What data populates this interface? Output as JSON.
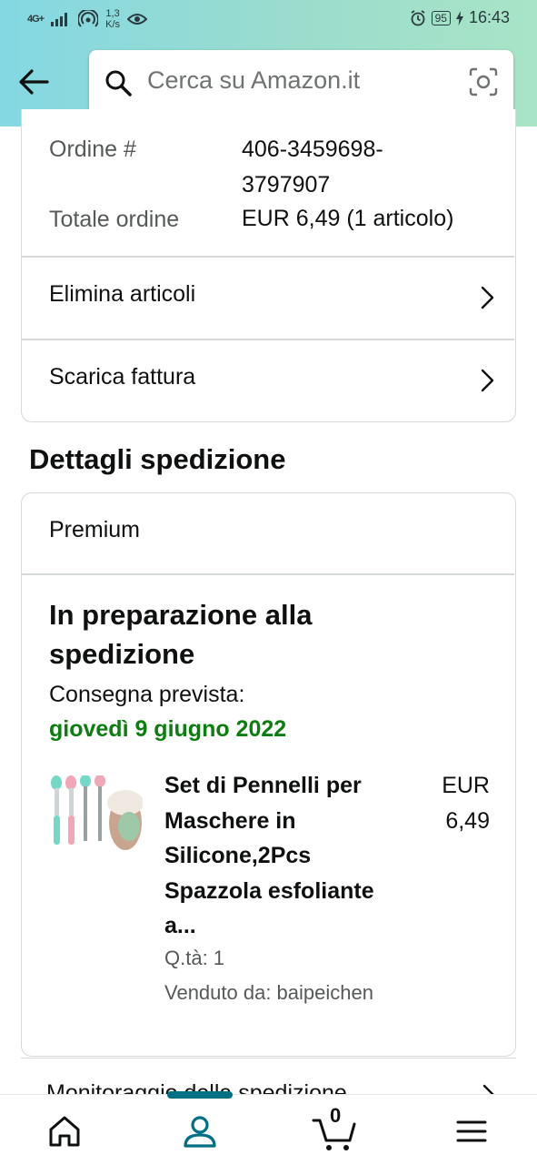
{
  "status_bar": {
    "network": "4G+",
    "speed_value": "1,3",
    "speed_unit": "K/s",
    "battery": "95",
    "time": "16:43"
  },
  "search": {
    "placeholder": "Cerca su Amazon.it"
  },
  "order": {
    "number_label": "Ordine #",
    "number_value": "406-3459698-\n3797907",
    "total_label": "Totale ordine",
    "total_value": "EUR 6,49 (1 articolo)"
  },
  "actions": {
    "delete_items": "Elimina articoli",
    "download_invoice": "Scarica fattura"
  },
  "shipping": {
    "section_title": "Dettagli spedizione",
    "service": "Premium",
    "status_title": "In preparazione alla spedizione",
    "eta_label": "Consegna prevista:",
    "eta_date": "giovedì 9 giugno 2022",
    "eta_color": "#0a7f10"
  },
  "item": {
    "title": "Set di Pennelli per Maschere in Silicone,2Pcs Spazzola esfoliante a...",
    "price": "EUR\n6,49",
    "qty": "Q.tà: 1",
    "seller": "Venduto da: baipeichen"
  },
  "tracking": {
    "label": "Monitoraggio della spedizione"
  },
  "bottom_nav": {
    "cart_count": "0",
    "accent": "#007185"
  }
}
